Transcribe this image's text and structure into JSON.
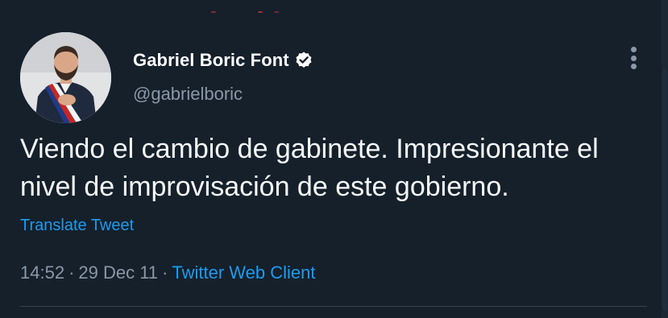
{
  "author": {
    "display_name": "Gabriel Boric Font",
    "handle": "@gabrielboric",
    "verified": true
  },
  "tweet": {
    "text": "Viendo el cambio de gabinete. Impresionante el nivel de improvisación de este gobierno.",
    "translate_label": "Translate Tweet",
    "time": "14:52",
    "date": "29 Dec 11",
    "separator": "·",
    "client": "Twitter Web Client"
  },
  "icons": {
    "verified": "verified-badge-icon",
    "more": "more-options-icon"
  },
  "colors": {
    "background": "#15202b",
    "primary_text": "#f7f9f9",
    "secondary_text": "#8b98a5",
    "accent": "#1d9bf0",
    "divider": "#38444d"
  }
}
